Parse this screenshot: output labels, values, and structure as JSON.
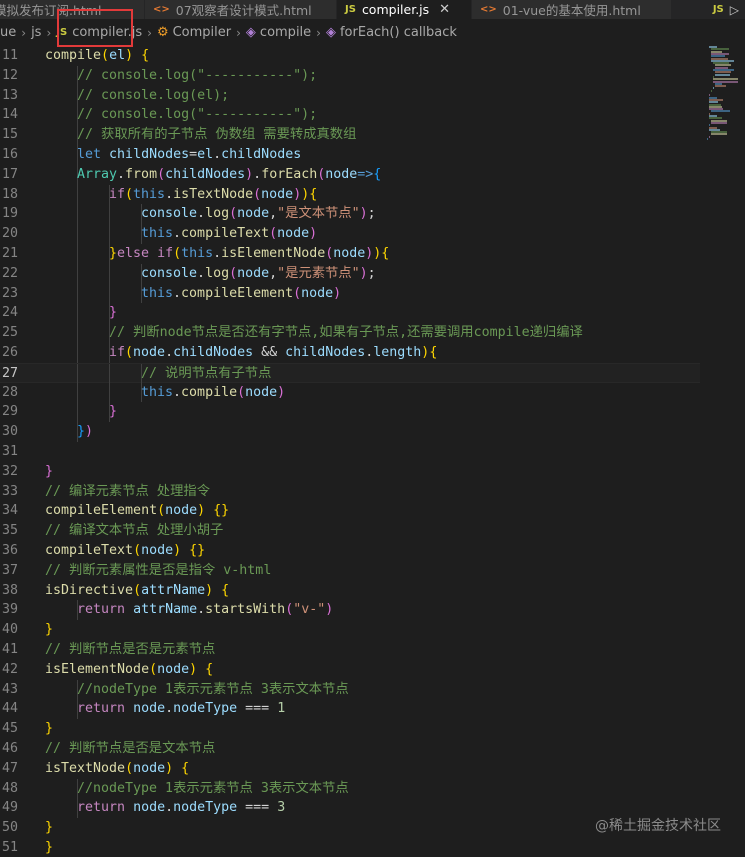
{
  "tabs": [
    {
      "label": "模拟发布订阅.html",
      "icon": "html-icon",
      "active": false
    },
    {
      "label": "07观察者设计模式.html",
      "icon": "html-icon",
      "active": false
    },
    {
      "label": "compiler.js",
      "icon": "js-icon",
      "active": true
    },
    {
      "label": "01-vue的基本使用.html",
      "icon": "html-icon",
      "active": false
    }
  ],
  "breadcrumb": {
    "folder1": "ue",
    "folder2": "js",
    "file_icon": "JS",
    "file": "compiler.js",
    "class": "Compiler",
    "method": "compile",
    "callback": "forEach() callback"
  },
  "editor": {
    "current_line": 27,
    "lines": [
      {
        "n": 11,
        "indent": 1,
        "tokens": [
          [
            "fn",
            "compile"
          ],
          [
            "p1",
            "("
          ],
          [
            "var",
            "el"
          ],
          [
            "p1",
            ")"
          ],
          [
            "op",
            " "
          ],
          [
            "p1",
            "{"
          ]
        ]
      },
      {
        "n": 12,
        "indent": 2,
        "tokens": [
          [
            "cmt",
            "// console.log(\"-----------\");"
          ]
        ]
      },
      {
        "n": 13,
        "indent": 2,
        "tokens": [
          [
            "cmt",
            "// console.log(el);"
          ]
        ]
      },
      {
        "n": 14,
        "indent": 2,
        "tokens": [
          [
            "cmt",
            "// console.log(\"-----------\");"
          ]
        ]
      },
      {
        "n": 15,
        "indent": 2,
        "tokens": [
          [
            "cmt",
            "// 获取所有的子节点 伪数组 需要转成真数组"
          ]
        ]
      },
      {
        "n": 16,
        "indent": 2,
        "tokens": [
          [
            "kw",
            "let"
          ],
          [
            "op",
            " "
          ],
          [
            "var",
            "childNodes"
          ],
          [
            "op",
            "="
          ],
          [
            "var",
            "el"
          ],
          [
            "op",
            "."
          ],
          [
            "var",
            "childNodes"
          ]
        ]
      },
      {
        "n": 17,
        "indent": 2,
        "tokens": [
          [
            "cls",
            "Array"
          ],
          [
            "op",
            "."
          ],
          [
            "fn",
            "from"
          ],
          [
            "p2",
            "("
          ],
          [
            "var",
            "childNodes"
          ],
          [
            "p2",
            ")"
          ],
          [
            "op",
            "."
          ],
          [
            "fn",
            "forEach"
          ],
          [
            "p2",
            "("
          ],
          [
            "var",
            "node"
          ],
          [
            "kw",
            "=>"
          ],
          [
            "p3",
            "{"
          ]
        ]
      },
      {
        "n": 18,
        "indent": 3,
        "tokens": [
          [
            "ctl",
            "if"
          ],
          [
            "p1",
            "("
          ],
          [
            "kw",
            "this"
          ],
          [
            "op",
            "."
          ],
          [
            "fn",
            "isTextNode"
          ],
          [
            "p2",
            "("
          ],
          [
            "var",
            "node"
          ],
          [
            "p2",
            ")"
          ],
          [
            "p1",
            ")"
          ],
          [
            "p1",
            "{"
          ]
        ]
      },
      {
        "n": 19,
        "indent": 4,
        "tokens": [
          [
            "var",
            "console"
          ],
          [
            "op",
            "."
          ],
          [
            "fn",
            "log"
          ],
          [
            "p2",
            "("
          ],
          [
            "var",
            "node"
          ],
          [
            "op",
            ","
          ],
          [
            "str",
            "\"是文本节点\""
          ],
          [
            "p2",
            ")"
          ],
          [
            "op",
            ";"
          ]
        ]
      },
      {
        "n": 20,
        "indent": 4,
        "tokens": [
          [
            "kw",
            "this"
          ],
          [
            "op",
            "."
          ],
          [
            "fn",
            "compileText"
          ],
          [
            "p2",
            "("
          ],
          [
            "var",
            "node"
          ],
          [
            "p2",
            ")"
          ]
        ]
      },
      {
        "n": 21,
        "indent": 3,
        "tokens": [
          [
            "p1",
            "}"
          ],
          [
            "ctl",
            "else"
          ],
          [
            "op",
            " "
          ],
          [
            "ctl",
            "if"
          ],
          [
            "p1",
            "("
          ],
          [
            "kw",
            "this"
          ],
          [
            "op",
            "."
          ],
          [
            "fn",
            "isElementNode"
          ],
          [
            "p2",
            "("
          ],
          [
            "var",
            "node"
          ],
          [
            "p2",
            ")"
          ],
          [
            "p1",
            ")"
          ],
          [
            "p1",
            "{"
          ]
        ]
      },
      {
        "n": 22,
        "indent": 4,
        "tokens": [
          [
            "var",
            "console"
          ],
          [
            "op",
            "."
          ],
          [
            "fn",
            "log"
          ],
          [
            "p2",
            "("
          ],
          [
            "var",
            "node"
          ],
          [
            "op",
            ","
          ],
          [
            "str",
            "\"是元素节点\""
          ],
          [
            "p2",
            ")"
          ],
          [
            "op",
            ";"
          ]
        ]
      },
      {
        "n": 23,
        "indent": 4,
        "tokens": [
          [
            "kw",
            "this"
          ],
          [
            "op",
            "."
          ],
          [
            "fn",
            "compileElement"
          ],
          [
            "p2",
            "("
          ],
          [
            "var",
            "node"
          ],
          [
            "p2",
            ")"
          ]
        ]
      },
      {
        "n": 24,
        "indent": 3,
        "tokens": [
          [
            "p2",
            "}"
          ]
        ]
      },
      {
        "n": 25,
        "indent": 3,
        "tokens": [
          [
            "cmt",
            "// 判断node节点是否还有字节点,如果有子节点,还需要调用compile递归编译"
          ]
        ]
      },
      {
        "n": 26,
        "indent": 3,
        "tokens": [
          [
            "ctl",
            "if"
          ],
          [
            "p1",
            "("
          ],
          [
            "var",
            "node"
          ],
          [
            "op",
            "."
          ],
          [
            "var",
            "childNodes"
          ],
          [
            "op",
            " && "
          ],
          [
            "var",
            "childNodes"
          ],
          [
            "op",
            "."
          ],
          [
            "var",
            "length"
          ],
          [
            "p1",
            ")"
          ],
          [
            "p1",
            "{"
          ]
        ]
      },
      {
        "n": 27,
        "indent": 4,
        "tokens": [
          [
            "cmt",
            "// 说明节点有子节点"
          ]
        ]
      },
      {
        "n": 28,
        "indent": 4,
        "tokens": [
          [
            "kw",
            "this"
          ],
          [
            "op",
            "."
          ],
          [
            "fn",
            "compile"
          ],
          [
            "p2",
            "("
          ],
          [
            "var",
            "node"
          ],
          [
            "p2",
            ")"
          ]
        ]
      },
      {
        "n": 29,
        "indent": 3,
        "tokens": [
          [
            "p2",
            "}"
          ]
        ]
      },
      {
        "n": 30,
        "indent": 2,
        "tokens": [
          [
            "p3",
            "}"
          ],
          [
            "p2",
            ")"
          ]
        ]
      },
      {
        "n": 31,
        "indent": 0,
        "tokens": []
      },
      {
        "n": 32,
        "indent": 1,
        "tokens": [
          [
            "p2",
            "}"
          ]
        ]
      },
      {
        "n": 33,
        "indent": 1,
        "tokens": [
          [
            "cmt",
            "// 编译元素节点 处理指令"
          ]
        ]
      },
      {
        "n": 34,
        "indent": 1,
        "tokens": [
          [
            "fn",
            "compileElement"
          ],
          [
            "p1",
            "("
          ],
          [
            "var",
            "node"
          ],
          [
            "p1",
            ")"
          ],
          [
            "op",
            " "
          ],
          [
            "p1",
            "{}"
          ]
        ]
      },
      {
        "n": 35,
        "indent": 1,
        "tokens": [
          [
            "cmt",
            "// 编译文本节点 处理小胡子"
          ]
        ]
      },
      {
        "n": 36,
        "indent": 1,
        "tokens": [
          [
            "fn",
            "compileText"
          ],
          [
            "p1",
            "("
          ],
          [
            "var",
            "node"
          ],
          [
            "p1",
            ")"
          ],
          [
            "op",
            " "
          ],
          [
            "p1",
            "{}"
          ]
        ]
      },
      {
        "n": 37,
        "indent": 1,
        "tokens": [
          [
            "cmt",
            "// 判断元素属性是否是指令 v-html"
          ]
        ]
      },
      {
        "n": 38,
        "indent": 1,
        "tokens": [
          [
            "fn",
            "isDirective"
          ],
          [
            "p1",
            "("
          ],
          [
            "var",
            "attrName"
          ],
          [
            "p1",
            ")"
          ],
          [
            "op",
            " "
          ],
          [
            "p1",
            "{"
          ]
        ]
      },
      {
        "n": 39,
        "indent": 2,
        "tokens": [
          [
            "ctl",
            "return"
          ],
          [
            "op",
            " "
          ],
          [
            "var",
            "attrName"
          ],
          [
            "op",
            "."
          ],
          [
            "fn",
            "startsWith"
          ],
          [
            "p2",
            "("
          ],
          [
            "str",
            "\"v-\""
          ],
          [
            "p2",
            ")"
          ]
        ]
      },
      {
        "n": 40,
        "indent": 1,
        "tokens": [
          [
            "p1",
            "}"
          ]
        ]
      },
      {
        "n": 41,
        "indent": 1,
        "tokens": [
          [
            "cmt",
            "// 判断节点是否是元素节点"
          ]
        ]
      },
      {
        "n": 42,
        "indent": 1,
        "tokens": [
          [
            "fn",
            "isElementNode"
          ],
          [
            "p1",
            "("
          ],
          [
            "var",
            "node"
          ],
          [
            "p1",
            ")"
          ],
          [
            "op",
            " "
          ],
          [
            "p1",
            "{"
          ]
        ]
      },
      {
        "n": 43,
        "indent": 2,
        "tokens": [
          [
            "cmt",
            "//nodeType 1表示元素节点 3表示文本节点"
          ]
        ]
      },
      {
        "n": 44,
        "indent": 2,
        "tokens": [
          [
            "ctl",
            "return"
          ],
          [
            "op",
            " "
          ],
          [
            "var",
            "node"
          ],
          [
            "op",
            "."
          ],
          [
            "var",
            "nodeType"
          ],
          [
            "op",
            " === "
          ],
          [
            "num",
            "1"
          ]
        ]
      },
      {
        "n": 45,
        "indent": 1,
        "tokens": [
          [
            "p1",
            "}"
          ]
        ]
      },
      {
        "n": 46,
        "indent": 1,
        "tokens": [
          [
            "cmt",
            "// 判断节点是否是文本节点"
          ]
        ]
      },
      {
        "n": 47,
        "indent": 1,
        "tokens": [
          [
            "fn",
            "isTextNode"
          ],
          [
            "p1",
            "("
          ],
          [
            "var",
            "node"
          ],
          [
            "p1",
            ")"
          ],
          [
            "op",
            " "
          ],
          [
            "p1",
            "{"
          ]
        ]
      },
      {
        "n": 48,
        "indent": 2,
        "tokens": [
          [
            "cmt",
            "//nodeType 1表示元素节点 3表示文本节点"
          ]
        ]
      },
      {
        "n": 49,
        "indent": 2,
        "tokens": [
          [
            "ctl",
            "return"
          ],
          [
            "op",
            " "
          ],
          [
            "var",
            "node"
          ],
          [
            "op",
            "."
          ],
          [
            "var",
            "nodeType"
          ],
          [
            "op",
            " === "
          ],
          [
            "num",
            "3"
          ]
        ]
      },
      {
        "n": 50,
        "indent": 1,
        "tokens": [
          [
            "p1",
            "}"
          ]
        ]
      },
      {
        "n": 51,
        "indent": 0,
        "tokens": [
          [
            "p1",
            "}"
          ]
        ]
      }
    ]
  },
  "watermark": "@稀土掘金技术社区",
  "colors": {
    "background": "#1e1e1e",
    "comment": "#6a9955",
    "keyword": "#569cd6",
    "control": "#c586c0",
    "function": "#dcdcaa",
    "variable": "#9cdcfe",
    "string": "#ce9178",
    "highlight_box": "#e23a3a"
  }
}
